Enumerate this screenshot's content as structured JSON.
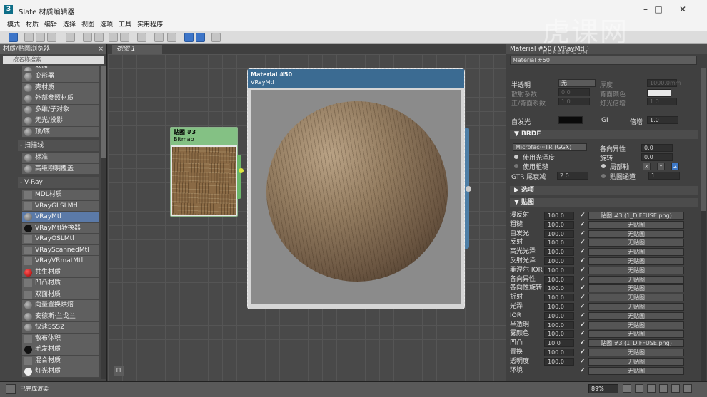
{
  "window": {
    "title": "Slate 材质编辑器",
    "logo": "3"
  },
  "menu": [
    "模式",
    "材质",
    "编辑",
    "选择",
    "视图",
    "选项",
    "工具",
    "实用程序"
  ],
  "browser": {
    "header": "材质/贴图浏览器",
    "close": "×",
    "search_placeholder": "按名称搜索...",
    "items_top": [
      "双面",
      "变形器",
      "壳材质",
      "外部参照材质",
      "多维/子对象",
      "无光/投影",
      "顶/底"
    ],
    "group_scanline": "- 扫描线",
    "items_scanline": [
      "标准",
      "高级照明覆盖"
    ],
    "group_vray": "- V-Ray",
    "items_vray": [
      "MDL材质",
      "VRayGLSLMtl",
      "VRayMtl",
      "VRayMtl转换器",
      "VRayOSLMtl",
      "VRayScannedMtl",
      "VRayVRmatMtl",
      "共生材质",
      "凹凸材质",
      "双面材质",
      "向量置换烘焙",
      "安德斯·兰戈兰",
      "快速SSS2",
      "散布体积",
      "毛发材质",
      "混合材质",
      "灯光材质"
    ]
  },
  "view": {
    "tab": "视图 1",
    "nav": "◀ ▶"
  },
  "nodes": {
    "bitmap": {
      "title": "贴图 #3",
      "type": "Bitmap"
    },
    "material": {
      "title": "Material #50",
      "type": "VRayMtl"
    }
  },
  "props": {
    "header": "Material #50  ( VRayMtl )",
    "name": "Material #50",
    "translucency": {
      "label": "半透明",
      "value": "无",
      "thickness_label": "厚度",
      "thickness": "1000.0mm"
    },
    "scatter": {
      "label": "散射系数",
      "value": "0.0",
      "backcolor_label": "背面颜色"
    },
    "fwdback": {
      "label": "正/背面系数",
      "value": "1.0",
      "lightmult_label": "灯光倍增",
      "lightmult": "1.0"
    },
    "selfillum": {
      "label": "自发光",
      "gi": "GI",
      "mult_label": "倍增",
      "mult": "1.0"
    },
    "brdf": {
      "title": "▼ BRDF",
      "type": "Microfac···TR (GGX)",
      "aniso_label": "各向异性",
      "aniso": "0.0",
      "rot_label": "旋转",
      "rot": "0.0",
      "glossy": "使用光泽度",
      "rough": "使用粗糙",
      "local_axis": "局部轴",
      "x": "X",
      "y": "Y",
      "z": "Z",
      "gtr_label": "GTR 尾衰减",
      "gtr": "2.0",
      "mapchan_label": "贴图通道",
      "mapchan": "1"
    },
    "options_title": "▶ 选项",
    "maps_title": "▼ 贴图",
    "maps": [
      {
        "name": "漫反射",
        "value": "100.0",
        "check": "✔",
        "map": "贴图 #3 (1_DIFFUSE.png)"
      },
      {
        "name": "粗糙",
        "value": "100.0",
        "check": "✔",
        "map": "无贴图"
      },
      {
        "name": "自发光",
        "value": "100.0",
        "check": "✔",
        "map": "无贴图"
      },
      {
        "name": "反射",
        "value": "100.0",
        "check": "✔",
        "map": "无贴图"
      },
      {
        "name": "高光光泽",
        "value": "100.0",
        "check": "✔",
        "map": "无贴图"
      },
      {
        "name": "反射光泽",
        "value": "100.0",
        "check": "✔",
        "map": "无贴图"
      },
      {
        "name": "菲涅尔 IOR",
        "value": "100.0",
        "check": "✔",
        "map": "无贴图"
      },
      {
        "name": "各向异性",
        "value": "100.0",
        "check": "✔",
        "map": "无贴图"
      },
      {
        "name": "各向性旋转",
        "value": "100.0",
        "check": "✔",
        "map": "无贴图"
      },
      {
        "name": "折射",
        "value": "100.0",
        "check": "✔",
        "map": "无贴图"
      },
      {
        "name": "光泽",
        "value": "100.0",
        "check": "✔",
        "map": "无贴图"
      },
      {
        "name": "IOR",
        "value": "100.0",
        "check": "✔",
        "map": "无贴图"
      },
      {
        "name": "半透明",
        "value": "100.0",
        "check": "✔",
        "map": "无贴图"
      },
      {
        "name": "雾颜色",
        "value": "100.0",
        "check": "✔",
        "map": "无贴图"
      },
      {
        "name": "凹凸",
        "value": "10.0",
        "check": "✔",
        "map": "贴图 #3 (1_DIFFUSE.png)"
      },
      {
        "name": "置换",
        "value": "100.0",
        "check": "✔",
        "map": "无贴图"
      },
      {
        "name": "透明度",
        "value": "100.0",
        "check": "✔",
        "map": "无贴图"
      },
      {
        "name": "环境",
        "value": "",
        "check": "✔",
        "map": "无贴图"
      }
    ]
  },
  "status": {
    "text": "已完成渲染",
    "zoom": "89%"
  },
  "watermark": {
    "text": "虎课网",
    "sub": "HUKE88.COM"
  },
  "colors": {
    "vray_node_header": "#3b6b92",
    "bitmap_node_header": "#84c184",
    "selection": "#5b7aa8"
  }
}
